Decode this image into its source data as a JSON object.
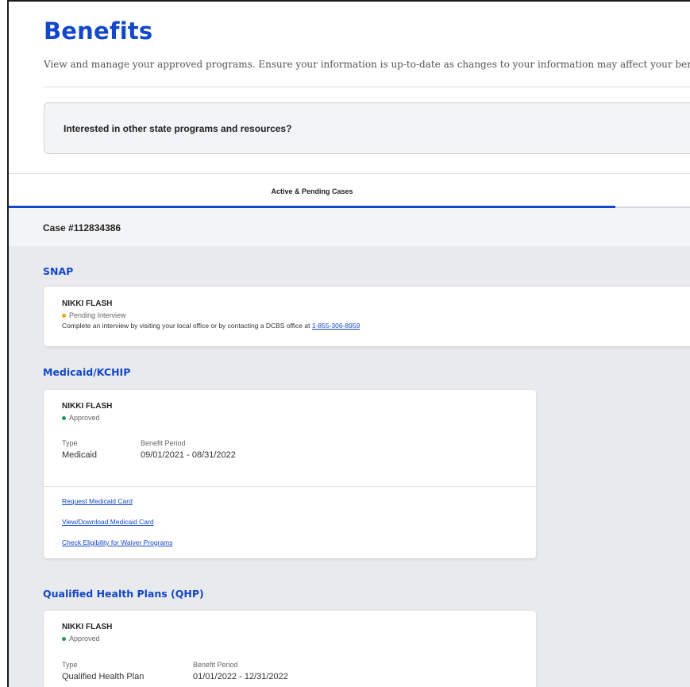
{
  "page": {
    "title": "Benefits",
    "description": "View and manage your approved programs. Ensure your information is up-to-date as changes to your information may affect your benefits."
  },
  "promo": {
    "text": "Interested in other state programs and resources?"
  },
  "tabs": [
    {
      "label": "Active & Pending Cases",
      "active": true
    }
  ],
  "case": {
    "number": "Case #112834386"
  },
  "programs": {
    "snap": {
      "title": "SNAP",
      "name": "NIKKI FLASH",
      "status": "Pending Interview",
      "message": "Complete an interview by visiting your local office or by contacting a DCBS office at",
      "phone": "1-855-306-8959"
    },
    "medicaid": {
      "title": "Medicaid/KCHIP",
      "name": "NIKKI FLASH",
      "status": "Approved",
      "type_label": "Type",
      "type_value": "Medicaid",
      "period_label": "Benefit Period",
      "period_value": "09/01/2021 - 08/31/2022",
      "links": [
        "Request Medicaid Card",
        "View/Download Medicaid Card",
        "Check Eligibility for Waiver Programs"
      ]
    },
    "qhp": {
      "title": "Qualified Health Plans (QHP)",
      "name": "NIKKI FLASH",
      "status": "Approved",
      "type_label": "Type",
      "type_value": "Qualified Health Plan",
      "period_label": "Benefit Period",
      "period_value": "01/01/2022 - 12/31/2022"
    }
  },
  "colors": {
    "brand_blue": "#1347c9",
    "pending": "#f2a400",
    "approved": "#1c9b4c"
  }
}
